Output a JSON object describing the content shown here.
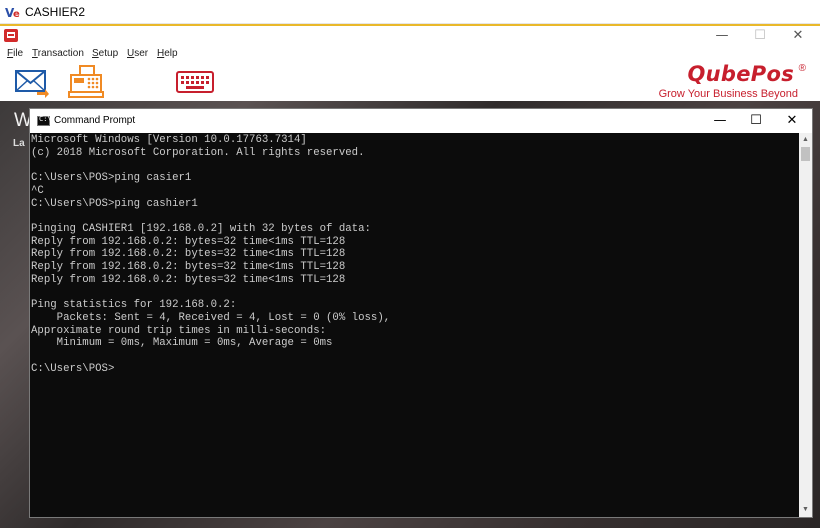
{
  "outer_window": {
    "title": "CASHIER2",
    "logo_text": "Ve"
  },
  "app": {
    "controls": {
      "minimize": "—",
      "maximize": "☐",
      "close": "✕"
    },
    "menu": [
      {
        "label": "File",
        "underline": "F",
        "rest": "ile"
      },
      {
        "label": "Transaction",
        "underline": "T",
        "rest": "ransaction"
      },
      {
        "label": "Setup",
        "underline": "S",
        "rest": "etup"
      },
      {
        "label": "User",
        "underline": "U",
        "rest": "ser"
      },
      {
        "label": "Help",
        "underline": "H",
        "rest": "elp"
      }
    ],
    "toolbar_icons": [
      "mail-icon",
      "cash-register-icon",
      "keyboard-icon"
    ],
    "brand": {
      "name": "QubePos",
      "registered": "®",
      "tagline": "Grow Your Business Beyond"
    },
    "background": {
      "heading": "W",
      "subtext": "La"
    }
  },
  "cmd": {
    "title": "Command Prompt",
    "icon_text": "C:\\",
    "controls": {
      "minimize": "—",
      "maximize": "☐",
      "close": "✕"
    },
    "lines": [
      "Microsoft Windows [Version 10.0.17763.7314]",
      "(c) 2018 Microsoft Corporation. All rights reserved.",
      "",
      "C:\\Users\\POS>ping casier1",
      "^C",
      "C:\\Users\\POS>ping cashier1",
      "",
      "Pinging CASHIER1 [192.168.0.2] with 32 bytes of data:",
      "Reply from 192.168.0.2: bytes=32 time<1ms TTL=128",
      "Reply from 192.168.0.2: bytes=32 time<1ms TTL=128",
      "Reply from 192.168.0.2: bytes=32 time<1ms TTL=128",
      "Reply from 192.168.0.2: bytes=32 time<1ms TTL=128",
      "",
      "Ping statistics for 192.168.0.2:",
      "    Packets: Sent = 4, Received = 4, Lost = 0 (0% loss),",
      "Approximate round trip times in milli-seconds:",
      "    Minimum = 0ms, Maximum = 0ms, Average = 0ms",
      "",
      "C:\\Users\\POS>"
    ],
    "scrollbar": {
      "up": "▲",
      "down": "▼"
    }
  },
  "colors": {
    "accent_gold": "#e9b82a",
    "brand_red": "#c71f2d",
    "icon_blue": "#1e5aa8",
    "icon_orange": "#f08a24",
    "console_bg": "#0c0c0c",
    "console_text": "#cccccc"
  }
}
